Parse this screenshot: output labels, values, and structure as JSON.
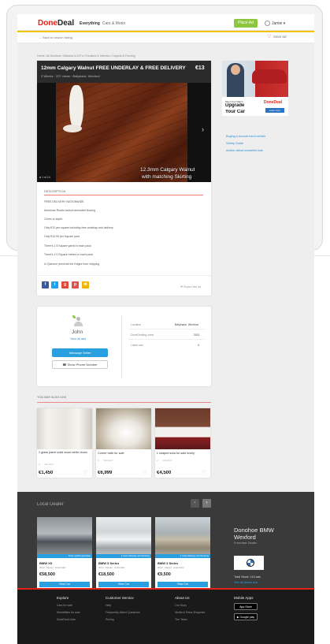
{
  "header": {
    "logo_a": "Done",
    "logo_b": "Deal",
    "nav": [
      "Everything",
      "Cars & Motor"
    ],
    "place_ad": "Place Ad",
    "user": "Jamie"
  },
  "subbar": {
    "back": "Back to search listing",
    "save": "Save ad"
  },
  "breadcrumb": "Home  /  All Sections  /  Wicklow & DIY's  /  Furniture & Interiors  /  Carpets & Flooring",
  "listing": {
    "title": "12mm Calgary Walnut FREE UNDERLAY & FREE DELIVERY",
    "meta": "3 Weeks  ·  227 views  ·  Ballyhack, Wexford",
    "price": "€13",
    "photo_caption_1": "12.3mm Calgary Walnut",
    "photo_caption_2": "with matching Skirting",
    "photo_count": "1 of 14",
    "description_heading": "DESCRIPTION",
    "description": [
      "FREE DELIVERY NATIONWIDE",
      "American Rustic walnut laminated flooring",
      "12mm in depth",
      "Only €13 per square including free underlay and delivery",
      "Only €13.99  per Square yard",
      "There's 2.5 Square yards in each pack",
      "There's 2.0 Square meters in each pack",
      "In Quinone prevents the Edges from chipping"
    ],
    "report": "Report this ad"
  },
  "ad": {
    "meet": "Meet Your Match",
    "upgrade": "Upgrade",
    "your_car": "Your Car",
    "logo": "DoneDeal",
    "button": "Learn more"
  },
  "related_links": [
    "Buying a second hand vehicle",
    "Safety Guide",
    "Advice about unwanted ads"
  ],
  "seller": {
    "name": "John",
    "view_ads": "View all ads",
    "message": "Message Seller",
    "phone": "Show Phone Number",
    "details": [
      {
        "key": "Location",
        "value": "Ballyhack, Wexford"
      },
      {
        "key": "DoneDealing since",
        "value": "2011"
      },
      {
        "key": "Listed ads",
        "value": "4"
      }
    ]
  },
  "ymal": {
    "heading": "YOU MAY ALSO LIKE",
    "items": [
      {
        "title": "2 glass panel solid wood white doors",
        "meta": "2 ...  ·  Wexford",
        "price": "€1,450"
      },
      {
        "title": "Corner bath for sale",
        "meta": "2 ...  ·  Wexford",
        "price": "€6,999"
      },
      {
        "title": "L shaped sofa for sale lovely",
        "meta": "2 ...  ·  Wexford",
        "price": "€4,500"
      }
    ]
  },
  "dealer": {
    "heading": "Local Dealer",
    "name": "Donohoe BMW Wexford",
    "type": "Franchise Dealer",
    "total_stock": "Total Stock: 115 ads",
    "see_all": "See all dealer ads",
    "cars": [
      {
        "badge": "Three months guarantee",
        "name": "BMW X5",
        "spec": "2013  ·  Diesel  ·  Automatic",
        "price": "€58,500",
        "btn": "View Car"
      },
      {
        "badge": "2 Years Warranty and Servicing",
        "name": "BMW 5 Series",
        "spec": "2014  ·  Diesel  ·  Automatic",
        "price": "€18,500",
        "btn": "View Car"
      },
      {
        "badge": "2 Years Warranty and Servicing",
        "name": "BMW 3 Series",
        "spec": "2012  ·  Diesel  ·  Automatic",
        "price": "€9,500",
        "btn": "View Car"
      }
    ]
  },
  "footer": {
    "cols": [
      {
        "title": "Explore",
        "links": [
          "Cars for sale",
          "Motorbikes for sale",
          "DoneDeal Jobs"
        ]
      },
      {
        "title": "Customer Service",
        "links": [
          "Help",
          "Frequently Asked Questions",
          "Pricing"
        ]
      },
      {
        "title": "About Us",
        "links": [
          "Our Story",
          "Media & Press Enquiries",
          "The Team"
        ]
      },
      {
        "title": "Mobile Apps",
        "links": []
      }
    ],
    "app_store": "App Store",
    "google_play": "Google play"
  }
}
